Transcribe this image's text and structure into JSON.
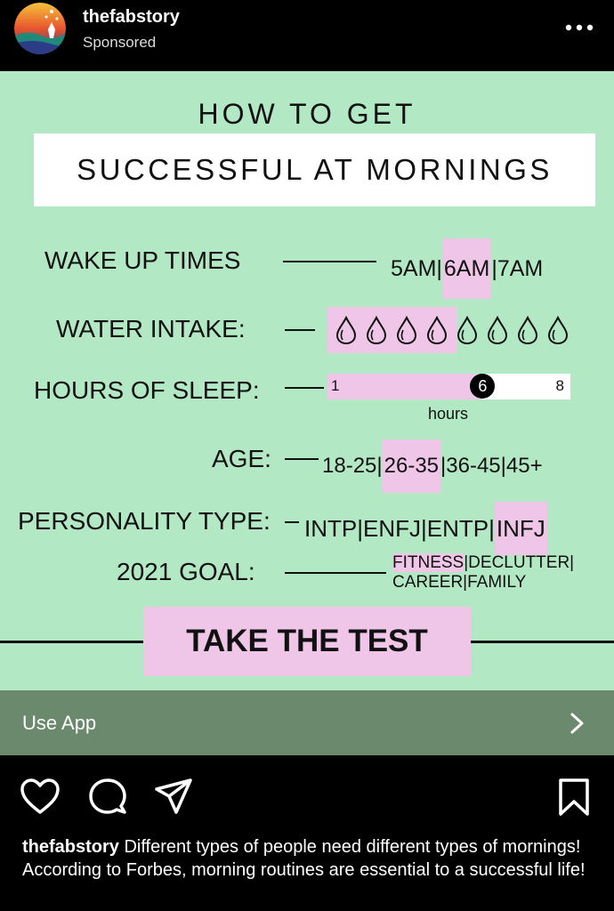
{
  "post": {
    "username": "thefabstory",
    "sponsored": "Sponsored"
  },
  "ad": {
    "title_line1": "HOW TO GET",
    "title_line2": "SUCCESSFUL AT MORNINGS",
    "wake": {
      "label": "WAKE UP TIMES",
      "options": [
        "5AM",
        "|",
        "6AM",
        "|",
        "7AM"
      ],
      "selected": "6AM"
    },
    "water": {
      "label": "WATER INTAKE:",
      "total_drops": 8,
      "selected_drops": 4
    },
    "sleep": {
      "label": "HOURS OF SLEEP:",
      "min": "1",
      "max": "8",
      "value": "6",
      "value_num": 6,
      "min_num": 1,
      "max_num": 8,
      "unit": "hours"
    },
    "age": {
      "label": "AGE:",
      "options": [
        "18-25",
        "|",
        "26-35",
        "|",
        "36-45",
        "|",
        "45+"
      ],
      "selected": "26-35"
    },
    "personality": {
      "label": "PERSONALITY TYPE:",
      "options": [
        "INTP",
        "|",
        "ENFJ",
        "|",
        "ENTP",
        "|",
        "INFJ"
      ],
      "selected": "INFJ"
    },
    "goal": {
      "label": "2021 GOAL:",
      "line1_selected": "FITNESS",
      "line1_rest": "|DECLUTTER|",
      "line2": "CAREER|FAMILY"
    },
    "cta": "TAKE THE TEST"
  },
  "use_app": {
    "label": "Use App"
  },
  "caption": {
    "username": "thefabstory",
    "text": " Different types of people need different types of mornings! According to Forbes, morning routines are essential to a successful life!"
  },
  "colors": {
    "ad_bg": "#b3e8c4",
    "highlight": "#f0c6e8",
    "use_app_bg": "#6b8a6d"
  },
  "icons": [
    "more-icon",
    "chevron-right-icon",
    "heart-icon",
    "comment-icon",
    "share-icon",
    "bookmark-icon",
    "water-drop-icon"
  ]
}
